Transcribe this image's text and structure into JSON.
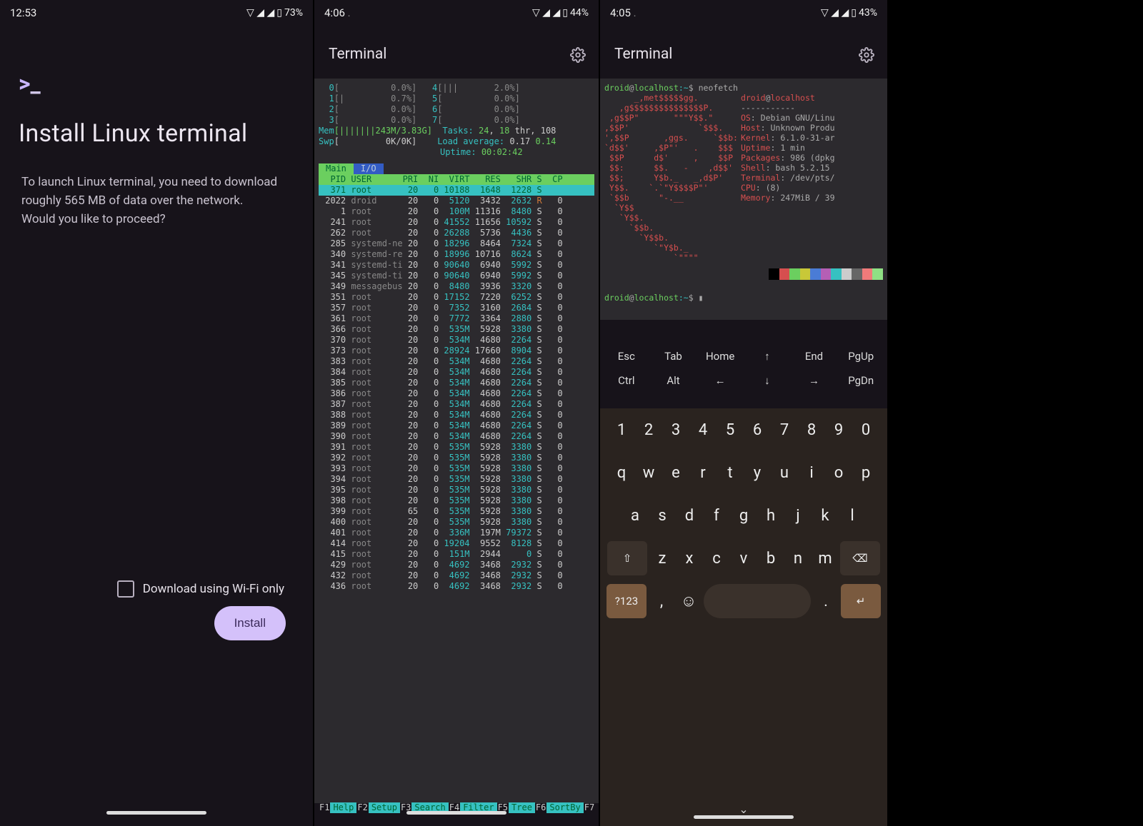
{
  "panel1": {
    "status": {
      "time": "12:53",
      "icons": "▽ ◢ ◢",
      "battery": "73%"
    },
    "prompt_gt": ">",
    "prompt_us": "_",
    "heading": "Install Linux terminal",
    "body_l1": "To launch Linux terminal, you need to download",
    "body_l2": "roughly 565 MB of data over the network.",
    "body_l3": "Would you like to proceed?",
    "wifi_label": "Download using Wi-Fi only",
    "install_label": "Install"
  },
  "panel2": {
    "status": {
      "time": "4:06",
      "dot": ".",
      "icons": "▽ ◢ ◢",
      "battery": "44%"
    },
    "title": "Terminal",
    "cpus": [
      {
        "n": "0",
        "bar": "[          0.0%]",
        "n2": "4",
        "bar2": "[|||       2.0%]"
      },
      {
        "n": "1",
        "bar": "[|         0.7%]",
        "n2": "5",
        "bar2": "[          0.0%]"
      },
      {
        "n": "2",
        "bar": "[          0.0%]",
        "n2": "6",
        "bar2": "[          0.0%]"
      },
      {
        "n": "3",
        "bar": "[          0.0%]",
        "n2": "7",
        "bar2": "[          0.0%]"
      }
    ],
    "mem_label": "Mem",
    "mem_bar": "[|||||||243M/3.83G]",
    "swp_label": "Swp",
    "swp_bar": "[         0K/0K]",
    "tasks_label": "Tasks:",
    "tasks_v": "24",
    "tasks_sep": ", ",
    "tasks_thr": "18",
    "tasks_suffix": " thr, 108",
    "load_label": "Load average:",
    "load_v1": "0.17",
    "load_v2": "0.14",
    "uptime_label": "Uptime:",
    "uptime_v": "00:02:42",
    "tabs": {
      "main": "Main",
      "io": "I/O"
    },
    "header": "  PID USER      PRI  NI  VIRT   RES   SHR S  CP",
    "rows": [
      {
        "sel": true,
        "pid": "371",
        "user": "root",
        "pri": "20",
        "ni": "0",
        "virt": "10188",
        "res": "1648",
        "shr": "1228",
        "s": "S",
        "cpu": ""
      },
      {
        "sel": false,
        "pid": "2022",
        "user": "droid",
        "pri": "20",
        "ni": "0",
        "virt": "5120",
        "res": "3432",
        "shr": "2632",
        "s": "R",
        "cpu": "0"
      },
      {
        "sel": false,
        "pid": "1",
        "user": "root",
        "pri": "20",
        "ni": "0",
        "virt": "100M",
        "res": "11316",
        "shr": "8480",
        "s": "S",
        "cpu": "0"
      },
      {
        "sel": false,
        "pid": "241",
        "user": "root",
        "pri": "20",
        "ni": "0",
        "virt": "41552",
        "res": "11656",
        "shr": "10592",
        "s": "S",
        "cpu": "0"
      },
      {
        "sel": false,
        "pid": "262",
        "user": "root",
        "pri": "20",
        "ni": "0",
        "virt": "26288",
        "res": "5736",
        "shr": "4436",
        "s": "S",
        "cpu": "0"
      },
      {
        "sel": false,
        "pid": "285",
        "user": "systemd-ne",
        "pri": "20",
        "ni": "0",
        "virt": "18296",
        "res": "8464",
        "shr": "7324",
        "s": "S",
        "cpu": "0"
      },
      {
        "sel": false,
        "pid": "340",
        "user": "systemd-re",
        "pri": "20",
        "ni": "0",
        "virt": "18996",
        "res": "10716",
        "shr": "8624",
        "s": "S",
        "cpu": "0"
      },
      {
        "sel": false,
        "pid": "341",
        "user": "systemd-ti",
        "pri": "20",
        "ni": "0",
        "virt": "90640",
        "res": "6940",
        "shr": "5992",
        "s": "S",
        "cpu": "0"
      },
      {
        "sel": false,
        "pid": "345",
        "user": "systemd-ti",
        "pri": "20",
        "ni": "0",
        "virt": "90640",
        "res": "6940",
        "shr": "5992",
        "s": "S",
        "cpu": "0"
      },
      {
        "sel": false,
        "pid": "349",
        "user": "messagebus",
        "pri": "20",
        "ni": "0",
        "virt": "8480",
        "res": "3936",
        "shr": "3320",
        "s": "S",
        "cpu": "0"
      },
      {
        "sel": false,
        "pid": "351",
        "user": "root",
        "pri": "20",
        "ni": "0",
        "virt": "17152",
        "res": "7220",
        "shr": "6252",
        "s": "S",
        "cpu": "0"
      },
      {
        "sel": false,
        "pid": "357",
        "user": "root",
        "pri": "20",
        "ni": "0",
        "virt": "7352",
        "res": "3160",
        "shr": "2684",
        "s": "S",
        "cpu": "0"
      },
      {
        "sel": false,
        "pid": "361",
        "user": "root",
        "pri": "20",
        "ni": "0",
        "virt": "7772",
        "res": "3364",
        "shr": "2880",
        "s": "S",
        "cpu": "0"
      },
      {
        "sel": false,
        "pid": "366",
        "user": "root",
        "pri": "20",
        "ni": "0",
        "virt": "535M",
        "res": "5928",
        "shr": "3380",
        "s": "S",
        "cpu": "0"
      },
      {
        "sel": false,
        "pid": "370",
        "user": "root",
        "pri": "20",
        "ni": "0",
        "virt": "534M",
        "res": "4680",
        "shr": "2264",
        "s": "S",
        "cpu": "0"
      },
      {
        "sel": false,
        "pid": "373",
        "user": "root",
        "pri": "20",
        "ni": "0",
        "virt": "28924",
        "res": "17660",
        "shr": "8904",
        "s": "S",
        "cpu": "0"
      },
      {
        "sel": false,
        "pid": "383",
        "user": "root",
        "pri": "20",
        "ni": "0",
        "virt": "534M",
        "res": "4680",
        "shr": "2264",
        "s": "S",
        "cpu": "0"
      },
      {
        "sel": false,
        "pid": "384",
        "user": "root",
        "pri": "20",
        "ni": "0",
        "virt": "534M",
        "res": "4680",
        "shr": "2264",
        "s": "S",
        "cpu": "0"
      },
      {
        "sel": false,
        "pid": "385",
        "user": "root",
        "pri": "20",
        "ni": "0",
        "virt": "534M",
        "res": "4680",
        "shr": "2264",
        "s": "S",
        "cpu": "0"
      },
      {
        "sel": false,
        "pid": "386",
        "user": "root",
        "pri": "20",
        "ni": "0",
        "virt": "534M",
        "res": "4680",
        "shr": "2264",
        "s": "S",
        "cpu": "0"
      },
      {
        "sel": false,
        "pid": "387",
        "user": "root",
        "pri": "20",
        "ni": "0",
        "virt": "534M",
        "res": "4680",
        "shr": "2264",
        "s": "S",
        "cpu": "0"
      },
      {
        "sel": false,
        "pid": "388",
        "user": "root",
        "pri": "20",
        "ni": "0",
        "virt": "534M",
        "res": "4680",
        "shr": "2264",
        "s": "S",
        "cpu": "0"
      },
      {
        "sel": false,
        "pid": "389",
        "user": "root",
        "pri": "20",
        "ni": "0",
        "virt": "534M",
        "res": "4680",
        "shr": "2264",
        "s": "S",
        "cpu": "0"
      },
      {
        "sel": false,
        "pid": "390",
        "user": "root",
        "pri": "20",
        "ni": "0",
        "virt": "534M",
        "res": "4680",
        "shr": "2264",
        "s": "S",
        "cpu": "0"
      },
      {
        "sel": false,
        "pid": "391",
        "user": "root",
        "pri": "20",
        "ni": "0",
        "virt": "535M",
        "res": "5928",
        "shr": "3380",
        "s": "S",
        "cpu": "0"
      },
      {
        "sel": false,
        "pid": "392",
        "user": "root",
        "pri": "20",
        "ni": "0",
        "virt": "535M",
        "res": "5928",
        "shr": "3380",
        "s": "S",
        "cpu": "0"
      },
      {
        "sel": false,
        "pid": "393",
        "user": "root",
        "pri": "20",
        "ni": "0",
        "virt": "535M",
        "res": "5928",
        "shr": "3380",
        "s": "S",
        "cpu": "0"
      },
      {
        "sel": false,
        "pid": "394",
        "user": "root",
        "pri": "20",
        "ni": "0",
        "virt": "535M",
        "res": "5928",
        "shr": "3380",
        "s": "S",
        "cpu": "0"
      },
      {
        "sel": false,
        "pid": "395",
        "user": "root",
        "pri": "20",
        "ni": "0",
        "virt": "535M",
        "res": "5928",
        "shr": "3380",
        "s": "S",
        "cpu": "0"
      },
      {
        "sel": false,
        "pid": "398",
        "user": "root",
        "pri": "20",
        "ni": "0",
        "virt": "535M",
        "res": "5928",
        "shr": "3380",
        "s": "S",
        "cpu": "0"
      },
      {
        "sel": false,
        "pid": "399",
        "user": "root",
        "pri": "65",
        "ni": "0",
        "virt": "535M",
        "res": "5928",
        "shr": "3380",
        "s": "S",
        "cpu": "0"
      },
      {
        "sel": false,
        "pid": "400",
        "user": "root",
        "pri": "20",
        "ni": "0",
        "virt": "535M",
        "res": "5928",
        "shr": "3380",
        "s": "S",
        "cpu": "0"
      },
      {
        "sel": false,
        "pid": "401",
        "user": "root",
        "pri": "20",
        "ni": "0",
        "virt": "336M",
        "res": "197M",
        "shr": "79372",
        "s": "S",
        "cpu": "0"
      },
      {
        "sel": false,
        "pid": "414",
        "user": "root",
        "pri": "20",
        "ni": "0",
        "virt": "19204",
        "res": "9552",
        "shr": "8128",
        "s": "S",
        "cpu": "0"
      },
      {
        "sel": false,
        "pid": "415",
        "user": "root",
        "pri": "20",
        "ni": "0",
        "virt": "151M",
        "res": "2944",
        "shr": "0",
        "s": "S",
        "cpu": "0"
      },
      {
        "sel": false,
        "pid": "429",
        "user": "root",
        "pri": "20",
        "ni": "0",
        "virt": "4692",
        "res": "3468",
        "shr": "2932",
        "s": "S",
        "cpu": "0"
      },
      {
        "sel": false,
        "pid": "432",
        "user": "root",
        "pri": "20",
        "ni": "0",
        "virt": "4692",
        "res": "3468",
        "shr": "2932",
        "s": "S",
        "cpu": "0"
      },
      {
        "sel": false,
        "pid": "436",
        "user": "root",
        "pri": "20",
        "ni": "0",
        "virt": "4692",
        "res": "3468",
        "shr": "2932",
        "s": "S",
        "cpu": "0"
      }
    ],
    "fkeys": [
      {
        "n": "F1",
        "l": "Help"
      },
      {
        "n": "F2",
        "l": "Setup"
      },
      {
        "n": "F3",
        "l": "Search"
      },
      {
        "n": "F4",
        "l": "Filter"
      },
      {
        "n": "F5",
        "l": "Tree"
      },
      {
        "n": "F6",
        "l": "SortBy"
      },
      {
        "n": "F7",
        "l": ""
      }
    ]
  },
  "panel3": {
    "status": {
      "time": "4:05",
      "dot": ".",
      "icons": "▽ ◢ ◢",
      "battery": "43%"
    },
    "title": "Terminal",
    "prompt": {
      "user": "droid",
      "at": "@",
      "host": "localhost",
      "path": ":~",
      "sep": "$ ",
      "cmd": "neofetch"
    },
    "ascii": [
      "      _,met$$$$$gg.",
      "   ,g$$$$$$$$$$$$$$$P.",
      " ,g$$P\"       \"\"\"Y$$.\"",
      ",$$P'              `$$$.",
      "',$$P       ,ggs.     `$$b:",
      "`d$$'     ,$P\"'   .    $$$",
      " $$P      d$'     ,    $$P",
      " $$:      $$.   -    ,d$$'",
      " $$;      Y$b._   _,d$P'",
      " Y$$.    `.`\"Y$$$$P\"'",
      " `$$b      \"-.__",
      "  `Y$$",
      "   `Y$$.",
      "     `$$b.",
      "       `Y$$b.",
      "          `\"Y$b._",
      "              `\"\"\"\""
    ],
    "info": [
      {
        "k": "droid",
        "at": "@",
        "v": "localhost"
      },
      {
        "k": "",
        "at": "",
        "v": "-----------"
      },
      {
        "k": "OS",
        "at": ": ",
        "v": "Debian GNU/Linu"
      },
      {
        "k": "Host",
        "at": ": ",
        "v": "Unknown Produ"
      },
      {
        "k": "Kernel",
        "at": ": ",
        "v": "6.1.0-31-ar"
      },
      {
        "k": "Uptime",
        "at": ": ",
        "v": "1 min"
      },
      {
        "k": "Packages",
        "at": ": ",
        "v": "986 (dpkg"
      },
      {
        "k": "Shell",
        "at": ": ",
        "v": "bash 5.2.15"
      },
      {
        "k": "Terminal",
        "at": ": ",
        "v": "/dev/pts/"
      },
      {
        "k": "CPU",
        "at": ": ",
        "v": "(8)"
      },
      {
        "k": "Memory",
        "at": ": ",
        "v": "247MiB / 39"
      }
    ],
    "colors": [
      "#000",
      "#d64f4f",
      "#6bcf5f",
      "#c8c838",
      "#4a7cd6",
      "#b55fb5",
      "#36c1c1",
      "#ccc",
      "#666",
      "#f07a7a",
      "#8fe084",
      "#e2e270",
      "#7aa4f0",
      "#d48ad4",
      "#6ad9d9",
      "#fff"
    ],
    "prompt2": {
      "user": "droid",
      "at": "@",
      "host": "localhost",
      "path": ":~",
      "sep": "$ ",
      "cursor": "▮"
    },
    "ext_row1": [
      "Esc",
      "Tab",
      "Home",
      "↑",
      "End",
      "PgUp"
    ],
    "ext_row2": [
      "Ctrl",
      "Alt",
      "←",
      "↓",
      "→",
      "PgDn"
    ],
    "num_row": [
      "1",
      "2",
      "3",
      "4",
      "5",
      "6",
      "7",
      "8",
      "9",
      "0"
    ],
    "row_q": [
      "q",
      "w",
      "e",
      "r",
      "t",
      "y",
      "u",
      "i",
      "o",
      "p"
    ],
    "row_a": [
      "a",
      "s",
      "d",
      "f",
      "g",
      "h",
      "j",
      "k",
      "l"
    ],
    "row_z": [
      "z",
      "x",
      "c",
      "v",
      "b",
      "n",
      "m"
    ],
    "shift": "⇧",
    "bksp": "⌫",
    "sym": "?123",
    "comma": ",",
    "emoji": "☺",
    "period": ".",
    "enter": "↵"
  }
}
